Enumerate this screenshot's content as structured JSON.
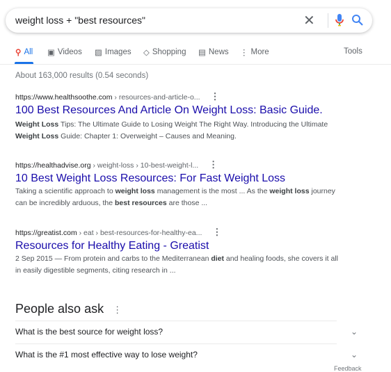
{
  "search": {
    "query": "weight loss + \"best resources\""
  },
  "tabs": [
    {
      "label": "All",
      "icon": "search-icon"
    },
    {
      "label": "Videos",
      "icon": "play-icon"
    },
    {
      "label": "Images",
      "icon": "image-icon"
    },
    {
      "label": "Shopping",
      "icon": "tag-icon"
    },
    {
      "label": "News",
      "icon": "news-icon"
    },
    {
      "label": "More",
      "icon": "more-vert-icon"
    }
  ],
  "tools_label": "Tools",
  "stats": "About 163,000 results (0.54 seconds)",
  "results": [
    {
      "domain": "https://www.healthsoothe.com",
      "path": " › resources-and-article-o...",
      "title": "100 Best Resources And Article On Weight Loss: Basic Guide.",
      "snippet": [
        {
          "b": true,
          "t": "Weight Loss"
        },
        {
          "t": " Tips: The Ultimate Guide to Losing Weight The Right Way. Introducing the Ultimate "
        },
        {
          "b": true,
          "t": "Weight Loss"
        },
        {
          "t": " Guide: Chapter 1: Overweight – Causes and Meaning."
        }
      ]
    },
    {
      "domain": "https://healthadvise.org",
      "path": " › weight-loss › 10-best-weight-l...",
      "title": "10 Best Weight Loss Resources: For Fast Weight Loss",
      "snippet": [
        {
          "t": "Taking a scientific approach to "
        },
        {
          "b": true,
          "t": "weight loss"
        },
        {
          "t": " management is the most ... As the "
        },
        {
          "b": true,
          "t": "weight loss"
        },
        {
          "t": " journey can be incredibly arduous, the "
        },
        {
          "b": true,
          "t": "best resources"
        },
        {
          "t": " are those ..."
        }
      ]
    },
    {
      "domain": "https://greatist.com",
      "path": " › eat › best-resources-for-healthy-ea...",
      "title": "Resources for Healthy Eating - Greatist",
      "snippet": [
        {
          "t": "2 Sep 2015 — From protein and carbs to the Mediterranean "
        },
        {
          "b": true,
          "t": "diet"
        },
        {
          "t": " and healing foods, she covers it all in easily digestible segments, citing research in ..."
        }
      ]
    }
  ],
  "paa": {
    "heading": "People also ask",
    "questions": [
      "What is the best source for weight loss?",
      "What is the #1 most effective way to lose weight?"
    ]
  },
  "feedback": "Feedback",
  "colors": {
    "link": "#1a0dab",
    "accent": "#1a73e8"
  }
}
